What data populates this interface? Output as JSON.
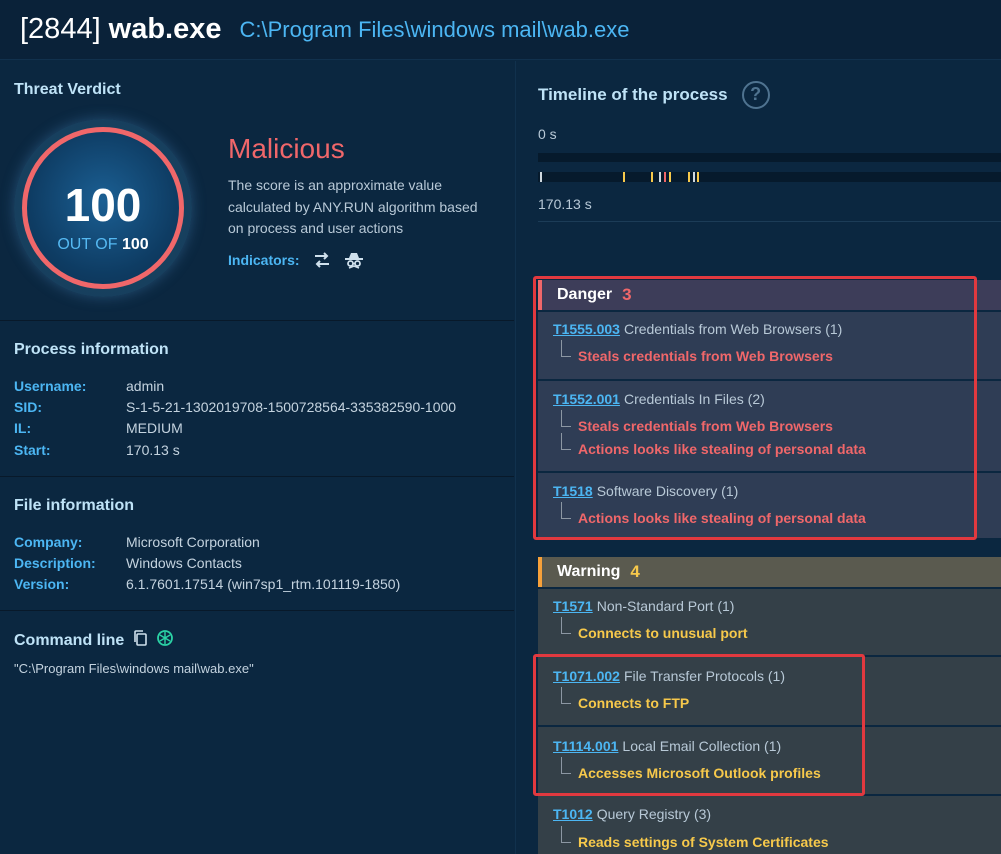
{
  "header": {
    "pid": "[2844]",
    "process_name": "wab.exe",
    "path": "C:\\Program Files\\windows mail\\wab.exe"
  },
  "verdict": {
    "title": "Threat Verdict",
    "score": "100",
    "out_of_label": "OUT OF",
    "out_of_value": "100",
    "label": "Malicious",
    "description": "The score is an approximate value calculated by ANY.RUN algorithm based on process and user actions",
    "indicators_label": "Indicators:",
    "indicator_icons": [
      "network-arrows-icon",
      "spy-icon"
    ]
  },
  "process_info": {
    "title": "Process information",
    "rows": [
      {
        "key": "Username:",
        "value": "admin"
      },
      {
        "key": "SID:",
        "value": "S-1-5-21-1302019708-1500728564-335382590-1000"
      },
      {
        "key": "IL:",
        "value": "MEDIUM"
      },
      {
        "key": "Start:",
        "value": "170.13 s"
      }
    ]
  },
  "file_info": {
    "title": "File information",
    "rows": [
      {
        "key": "Company:",
        "value": "Microsoft Corporation"
      },
      {
        "key": "Description:",
        "value": "Windows Contacts"
      },
      {
        "key": "Version:",
        "value": "6.1.7601.17514 (win7sp1_rtm.101119-1850)"
      }
    ]
  },
  "command_line": {
    "title": "Command line",
    "value": "\"C:\\Program Files\\windows mail\\wab.exe\""
  },
  "timeline": {
    "title": "Timeline of the process",
    "start_label": "0 s",
    "end_label": "170.13 s",
    "help_glyph": "?"
  },
  "danger": {
    "label": "Danger",
    "count": "3",
    "items": [
      {
        "id": "T1555.003",
        "name": "Credentials from Web Browsers (1)",
        "details": [
          "Steals credentials from Web Browsers"
        ]
      },
      {
        "id": "T1552.001",
        "name": "Credentials In Files (2)",
        "details": [
          "Steals credentials from Web Browsers",
          "Actions looks like stealing of personal data"
        ]
      },
      {
        "id": "T1518",
        "name": "Software Discovery (1)",
        "details": [
          "Actions looks like stealing of personal data"
        ]
      }
    ]
  },
  "warning": {
    "label": "Warning",
    "count": "4",
    "items": [
      {
        "id": "T1571",
        "name": "Non-Standard Port (1)",
        "details": [
          "Connects to unusual port"
        ]
      },
      {
        "id": "T1071.002",
        "name": "File Transfer Protocols (1)",
        "details": [
          "Connects to FTP"
        ]
      },
      {
        "id": "T1114.001",
        "name": "Local Email Collection (1)",
        "details": [
          "Accesses Microsoft Outlook profiles"
        ]
      },
      {
        "id": "T1012",
        "name": "Query Registry (3)",
        "details": [
          "Reads settings of System Certificates"
        ]
      }
    ]
  },
  "colors": {
    "danger": "#f0676a",
    "warning": "#f7c94b",
    "link": "#4cb6f3",
    "highlight": "#e2393f"
  }
}
